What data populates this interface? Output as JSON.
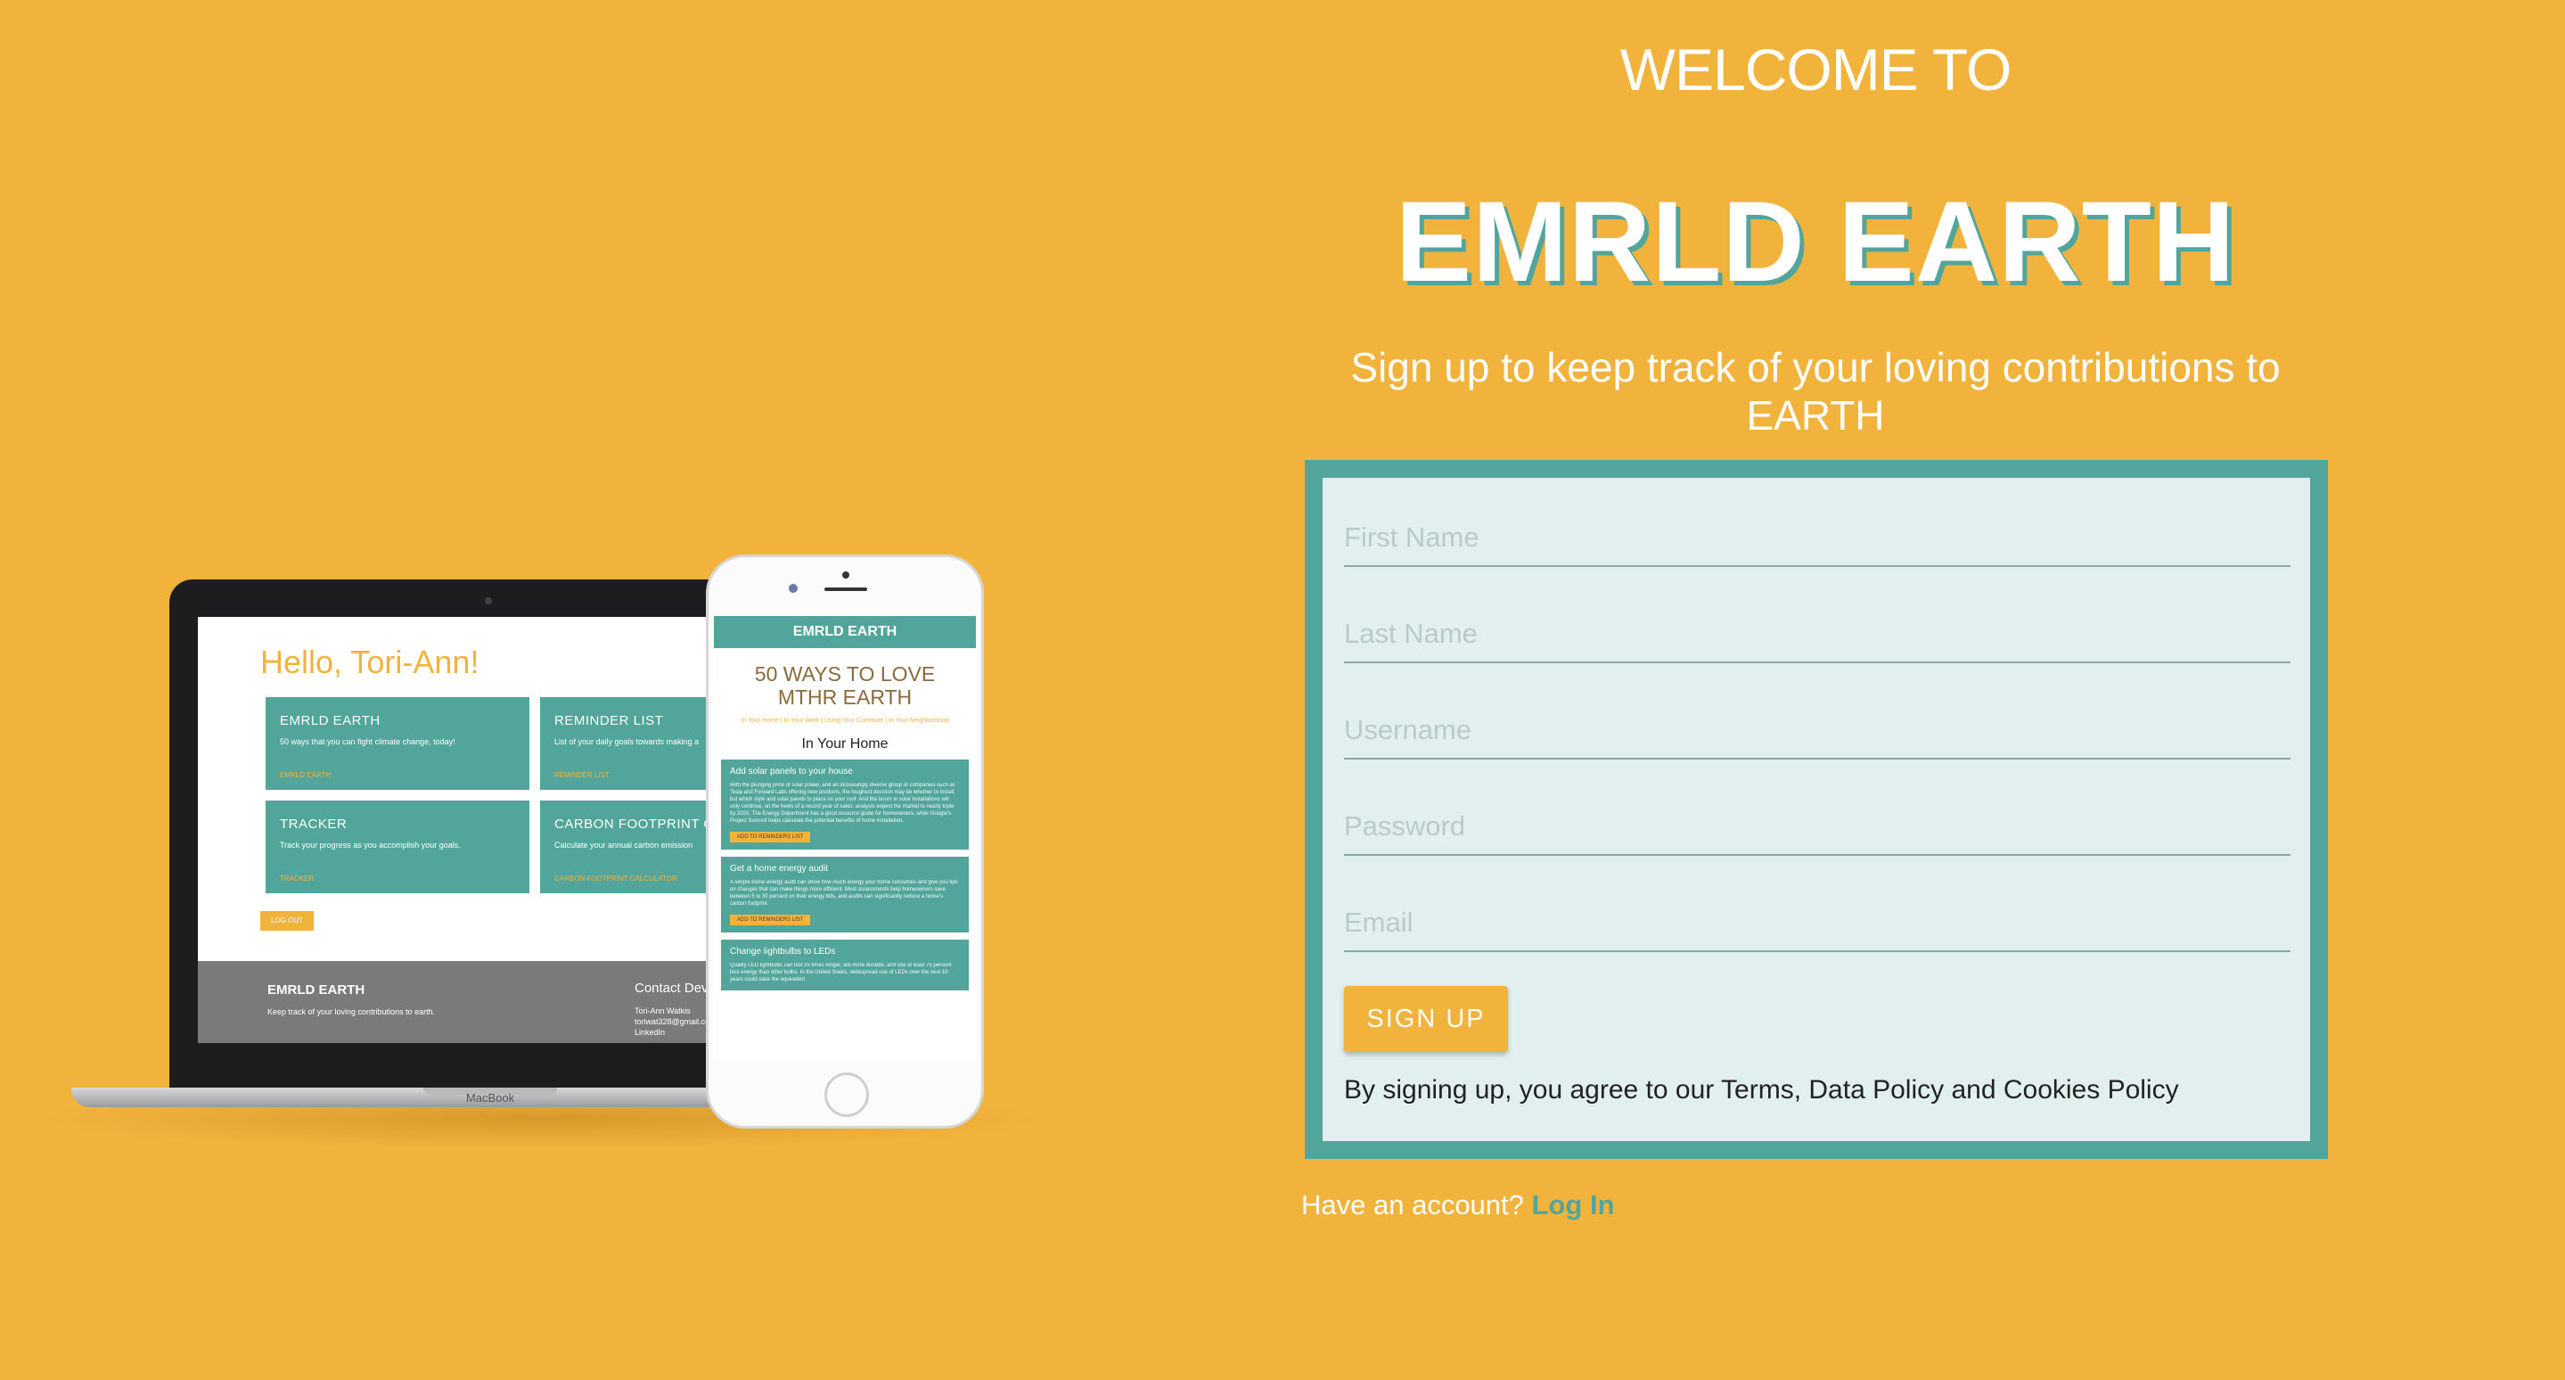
{
  "hero": {
    "welcome": "WELCOME TO",
    "brand": "EMRLD EARTH",
    "subtitle": "Sign up to keep track of your loving contributions to EARTH"
  },
  "mockup": {
    "laptop": {
      "greeting": "Hello, Tori-Ann!",
      "cards": [
        {
          "title": "EMRLD EARTH",
          "desc": "50 ways that you can fight climate change, today!",
          "link": "EMRLD EARTH"
        },
        {
          "title": "REMINDER LIST",
          "desc": "List of your daily goals towards making a",
          "link": "REMINDER LIST"
        },
        {
          "title": "TRACKER",
          "desc": "Track your progress as you accomplish your goals.",
          "link": "TRACKER"
        },
        {
          "title": "CARBON FOOTPRINT CALC",
          "desc": "Calculate your annual carbon emission",
          "link": "CARBON FOOTPRINT CALCULATOR"
        }
      ],
      "logout": "LOG OUT",
      "footer_brand": "EMRLD EARTH",
      "footer_tagline": "Keep track of your loving contributions to earth.",
      "footer_contact": "Contact Dev",
      "footer_name": "Tori-Ann Watkis",
      "footer_email": "toriwat328@gmail.com",
      "footer_linkedin": "LinkedIn",
      "brand_label": "MacBook"
    },
    "phone": {
      "header": "EMRLD EARTH",
      "title": "50 WAYS TO LOVE MTHR EARTH",
      "links": "In Your Home | In Your Work | Using Your Commute | In Your Neighborhood",
      "section": "In Your Home",
      "cards": [
        {
          "title": "Add solar panels to your house",
          "body": "With the plunging price of solar power, and an increasingly diverse group of companies such as Tesla and Forward Labs offering new products, the toughest decision may be whether to install, but which style and solar panels to place on your roof. And the boom in solar installations will only continue, on the heels of a record year of sales; analysts expect the market to nearly triple by 2020. The Energy Department has a good resource guide for homeowners, while Google's Project Sunroof helps calculate the potential benefits of home installation.",
          "button": "ADD TO REMINDERS LIST"
        },
        {
          "title": "Get a home energy audit",
          "body": "A simple home energy audit can show how much energy your home consumes and give you tips on changes that can make things more efficient. Most assessments help homeowners save between 5 to 30 percent on their energy bills, and audits can significantly reduce a home's carbon footprint.",
          "button": "ADD TO REMINDERS LIST"
        },
        {
          "title": "Change lightbulbs to LEDs",
          "body": "Quality LED lightbulbs can last 25 times longer, are more durable, and use at least 75 percent less energy than other bulbs. In the United States, widespread use of LEDs over the next 10 years could save the equivalent",
          "button": ""
        }
      ]
    }
  },
  "form": {
    "first_name_placeholder": "First Name",
    "last_name_placeholder": "Last Name",
    "username_placeholder": "Username",
    "password_placeholder": "Password",
    "email_placeholder": "Email",
    "signup_label": "SIGN UP",
    "terms": "By signing up, you agree to our Terms, Data Policy and Cookies Policy"
  },
  "footer": {
    "have_account": "Have an account?",
    "login_label": "Log In"
  },
  "colors": {
    "background": "#F2B33D",
    "teal": "#52A59A",
    "form_bg": "#E1F0EE"
  }
}
